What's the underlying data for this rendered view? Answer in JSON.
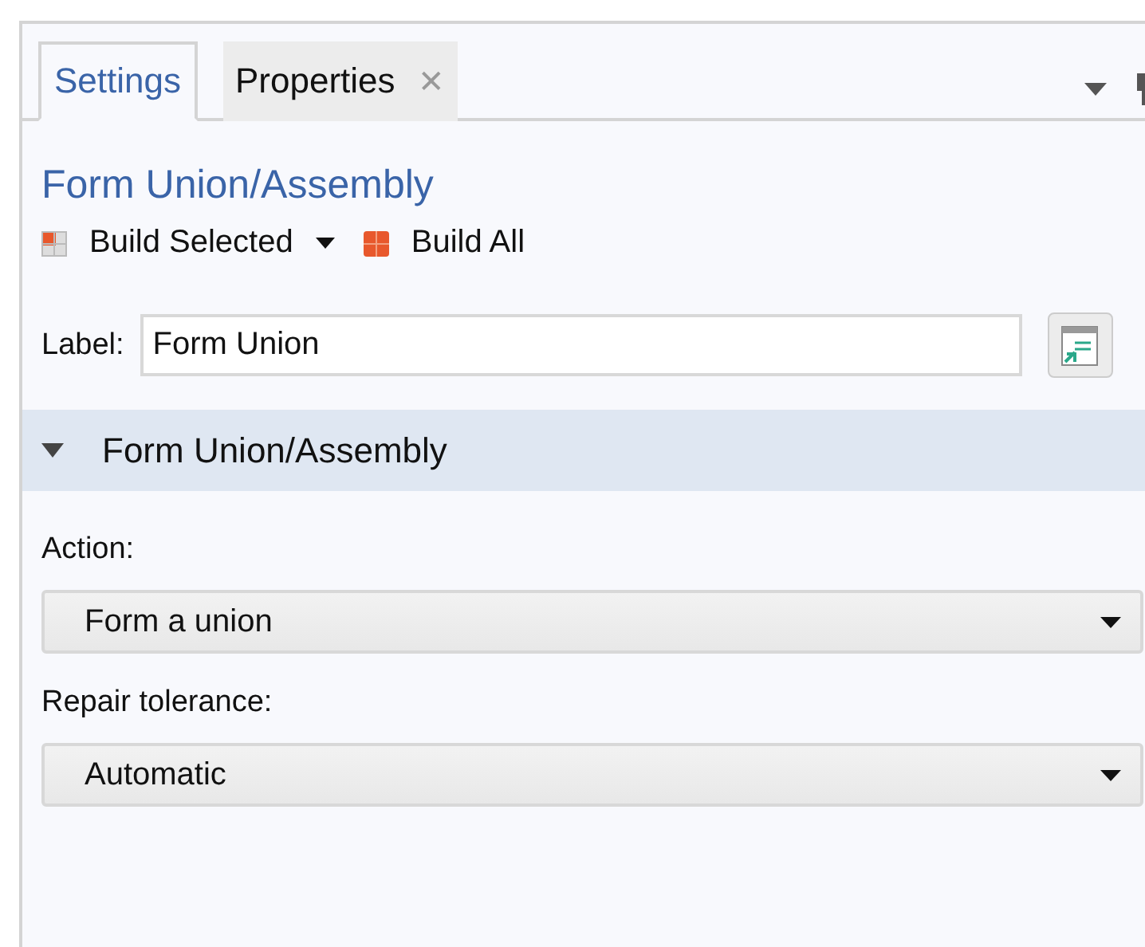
{
  "tabs": [
    {
      "label": "Settings",
      "selected": true,
      "closable": false
    },
    {
      "label": "Properties",
      "selected": false,
      "closable": true
    }
  ],
  "close_symbol": "✕",
  "title": "Form Union/Assembly",
  "toolbar": [
    {
      "kind": "build-selected",
      "label": "Build Selected",
      "has_menu": true
    },
    {
      "kind": "build-all",
      "label": "Build All",
      "has_menu": false
    }
  ],
  "label_field": {
    "label": "Label:",
    "value": "Form Union"
  },
  "section": {
    "title": "Form Union/Assembly",
    "expanded": true,
    "fields": [
      {
        "label": "Action:",
        "value": "Form a union"
      },
      {
        "label": "Repair tolerance:",
        "value": "Automatic"
      }
    ]
  }
}
